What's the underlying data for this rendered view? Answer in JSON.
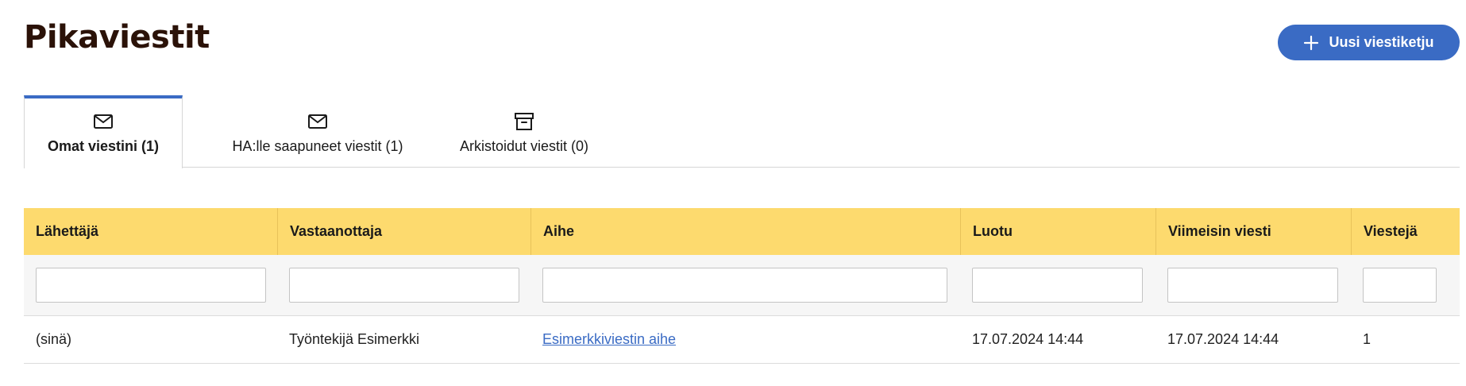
{
  "page": {
    "title": "Pikaviestit",
    "new_thread_label": "Uusi viestiketju"
  },
  "tabs": [
    {
      "label": "Omat viestini (1)",
      "icon": "envelope-icon",
      "active": true
    },
    {
      "label": "HA:lle saapuneet viestit (1)",
      "icon": "envelope-icon",
      "active": false
    },
    {
      "label": "Arkistoidut viestit (0)",
      "icon": "archive-icon",
      "active": false
    }
  ],
  "table": {
    "columns": [
      "Lähettäjä",
      "Vastaanottaja",
      "Aihe",
      "Luotu",
      "Viimeisin viesti",
      "Viestejä"
    ],
    "filters": [
      "",
      "",
      "",
      "",
      "",
      ""
    ],
    "rows": [
      {
        "sender": "(sinä)",
        "recipient": "Työntekijä Esimerkki",
        "subject": "Esimerkkiviestin aihe",
        "created": "17.07.2024 14:44",
        "latest": "17.07.2024 14:44",
        "count": "1"
      }
    ]
  },
  "colors": {
    "accent": "#3a6bc4",
    "header_bg": "#fdda6e",
    "title": "#2b1208"
  }
}
